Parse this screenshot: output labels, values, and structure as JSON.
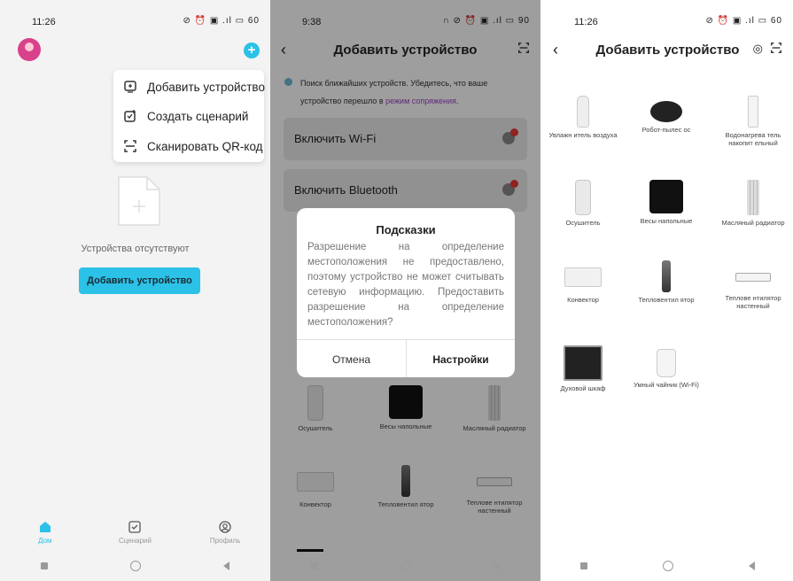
{
  "colors": {
    "accent": "#2cc1e6",
    "link": "#9c43c8",
    "alert": "#e53935"
  },
  "panel1": {
    "status": {
      "time": "11:26",
      "icons": "⊘ ⏰ ▣ .ıl ▭ 60"
    },
    "menu": [
      {
        "icon": "device-add-icon",
        "label": "Добавить устройство"
      },
      {
        "icon": "scenario-add-icon",
        "label": "Создать сценарий"
      },
      {
        "icon": "qr-scan-icon",
        "label": "Сканировать QR-код"
      }
    ],
    "empty_text": "Устройства отсутствуют",
    "add_button": "Добавить устройство",
    "tabs": [
      {
        "icon": "home-icon",
        "label": "Дом",
        "active": true
      },
      {
        "icon": "checklist-icon",
        "label": "Сценарий",
        "active": false
      },
      {
        "icon": "profile-icon",
        "label": "Профиль",
        "active": false
      }
    ]
  },
  "panel2": {
    "status": {
      "time": "9:38",
      "icons": "∩ ⊘ ⏰ ▣ .ıl ▭ 90"
    },
    "title": "Добавить устройство",
    "info_text": "Поиск ближайших устройств. Убедитесь, что ваше устройство перешло в ",
    "info_link": "режим сопряжения",
    "info_end": ".",
    "cards": [
      "Включить Wi-Fi",
      "Включить Bluetooth"
    ],
    "dialog": {
      "title": "Подсказки",
      "body": "Разрешение на определение местоположения не предоставлено, поэтому устройство не может считывать сетевую информацию. Предоставить разрешение на определение местоположения?",
      "cancel": "Отмена",
      "ok": "Настройки"
    },
    "devices": [
      {
        "name": "Осушитель",
        "img": "dehumidifier"
      },
      {
        "name": "Весы напольные",
        "img": "scale"
      },
      {
        "name": "Масляный радиатор",
        "img": "oil-radiator"
      },
      {
        "name": "Конвектор",
        "img": "convector"
      },
      {
        "name": "Тепловентил ятор",
        "img": "fan-heater"
      },
      {
        "name": "Теплове нтилятор настенный",
        "img": "wall-fan-heater"
      }
    ]
  },
  "panel3": {
    "status": {
      "time": "11:26",
      "icons": "⊘ ⏰ ▣ .ıl ▭ 60"
    },
    "title": "Добавить устройство",
    "devices": [
      {
        "name": "Увлажн итель воздуха",
        "img": "humidifier"
      },
      {
        "name": "Робот-пылес ос",
        "img": "robot-vacuum"
      },
      {
        "name": "Водонагрева тель накопит ельный",
        "img": "water-heater"
      },
      {
        "name": "Осушитель",
        "img": "dehumidifier"
      },
      {
        "name": "Весы напольные",
        "img": "scale"
      },
      {
        "name": "Масляный радиатор",
        "img": "oil-radiator"
      },
      {
        "name": "Конвектор",
        "img": "convector"
      },
      {
        "name": "Тепловентил ятор",
        "img": "fan-heater"
      },
      {
        "name": "Теплове нтилятор настенный",
        "img": "wall-fan-heater"
      },
      {
        "name": "Духовой шкаф",
        "img": "oven"
      },
      {
        "name": "Умный чайник (Wi-Fi)",
        "img": "kettle"
      }
    ]
  }
}
